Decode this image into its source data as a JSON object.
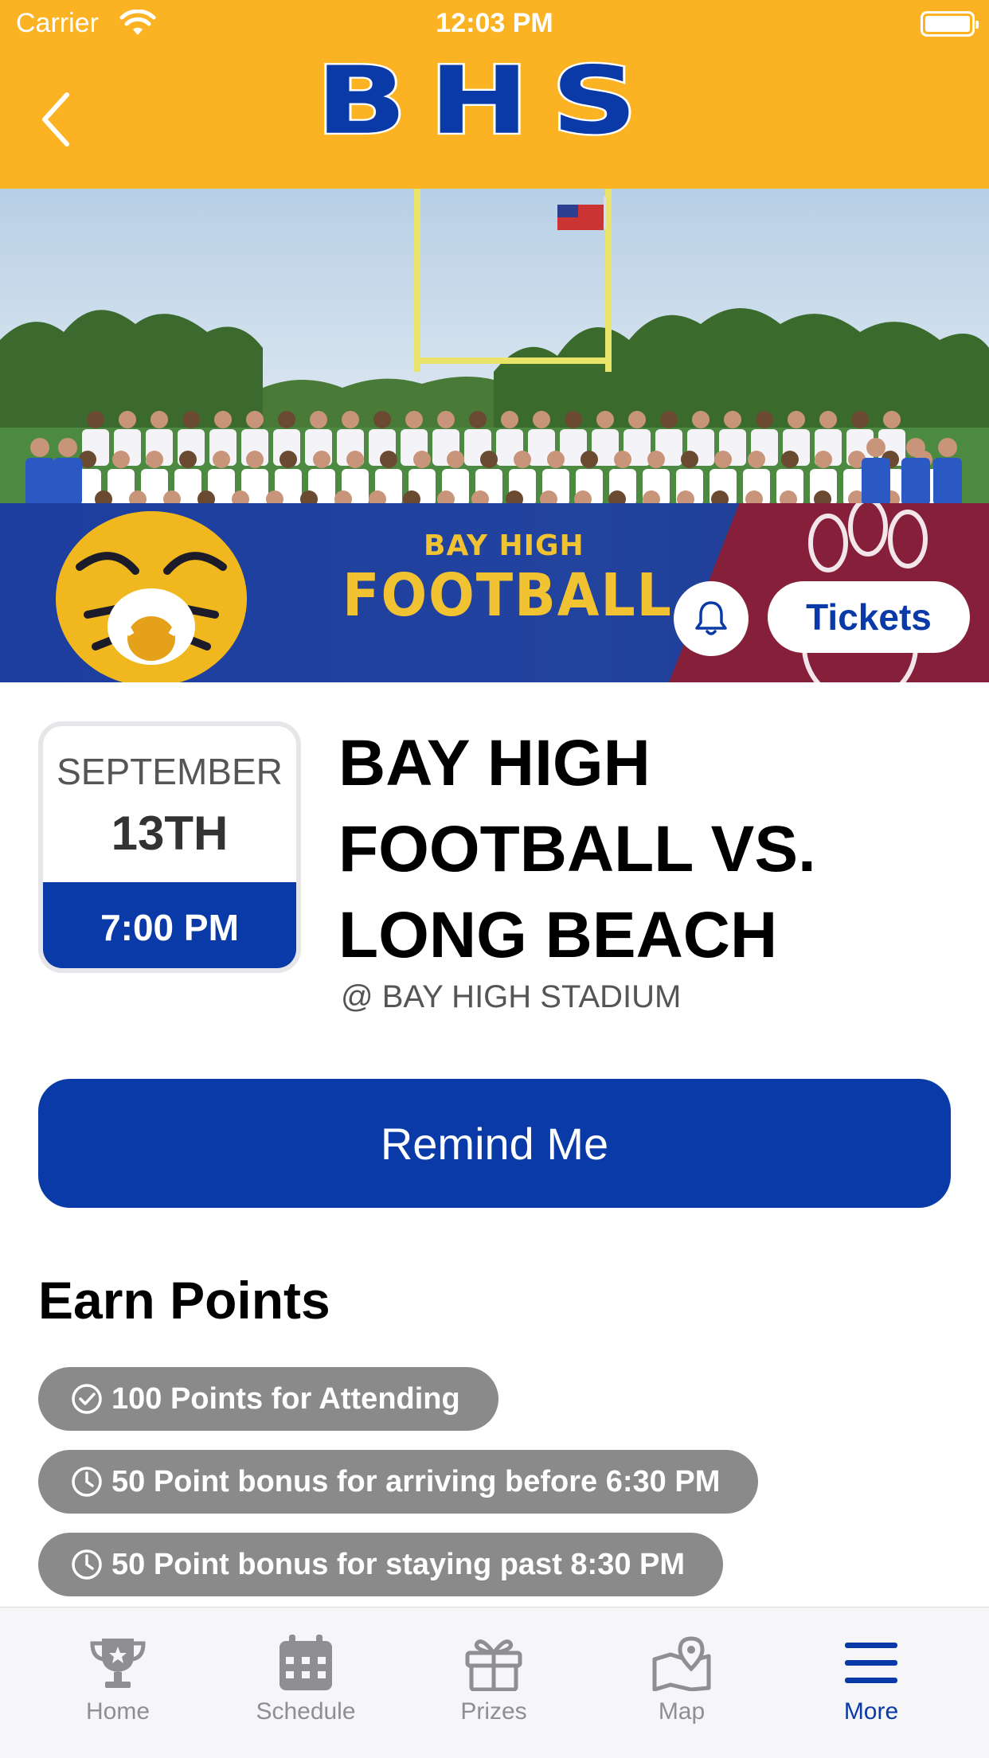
{
  "status_bar": {
    "carrier": "Carrier",
    "time": "12:03 PM"
  },
  "header": {
    "logo_text": "BHS",
    "back_icon": "chevron-left-icon",
    "background": "#fbb323"
  },
  "hero": {
    "banner_subtitle": "BAY HIGH",
    "banner_title": "FOOTBALL",
    "bell_icon": "bell-icon",
    "tickets_label": "Tickets"
  },
  "event": {
    "month": "SEPTEMBER",
    "day": "13TH",
    "time": "7:00 PM",
    "title": "BAY HIGH FOOTBALL VS. LONG BEACH",
    "venue": "@ BAY HIGH STADIUM"
  },
  "remind_button": {
    "label": "Remind Me"
  },
  "earn_points": {
    "heading": "Earn Points",
    "items": [
      {
        "icon": "check-circle-icon",
        "text": "100 Points for Attending"
      },
      {
        "icon": "clock-icon",
        "text": "50 Point bonus for arriving before 6:30 PM"
      },
      {
        "icon": "clock-icon",
        "text": "50 Point bonus for staying past 8:30 PM"
      }
    ]
  },
  "tabbar": {
    "items": [
      {
        "label": "Home",
        "icon": "trophy-icon",
        "active": false
      },
      {
        "label": "Schedule",
        "icon": "calendar-icon",
        "active": false
      },
      {
        "label": "Prizes",
        "icon": "gift-icon",
        "active": false
      },
      {
        "label": "Map",
        "icon": "map-icon",
        "active": false
      },
      {
        "label": "More",
        "icon": "menu-icon",
        "active": true
      }
    ]
  },
  "colors": {
    "brand_blue": "#0a3aa8",
    "brand_gold": "#fbb323",
    "pill_gray": "#8a8a8a"
  }
}
